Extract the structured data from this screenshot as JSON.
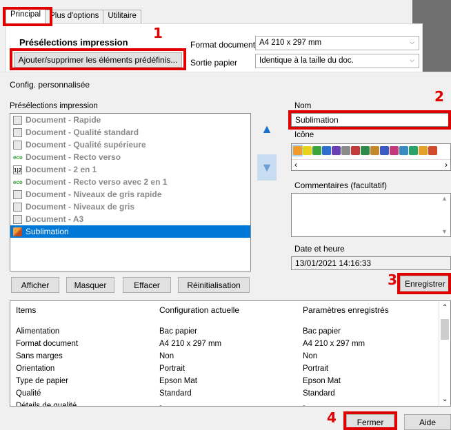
{
  "tabs": [
    {
      "label": "Principal",
      "active": true
    },
    {
      "label": "Plus d'options",
      "active": false
    },
    {
      "label": "Utilitaire",
      "active": false
    }
  ],
  "main": {
    "preset_title": "Présélections impression",
    "add_button": "Ajouter/supprimer les éléments prédéfinis...",
    "format_label": "Format document",
    "format_value": "A4 210 x 297 mm",
    "output_label": "Sortie papier",
    "output_value": "Identique à la taille du doc."
  },
  "dialog": {
    "title": "Config. personnalisée",
    "list_label": "Présélections impression",
    "presets": [
      {
        "label": "Document - Rapide",
        "icon": "document-icon"
      },
      {
        "label": "Document - Qualité standard",
        "icon": "document-icon"
      },
      {
        "label": "Document - Qualité supérieure",
        "icon": "document-icon"
      },
      {
        "label": "Document - Recto verso",
        "icon": "eco-icon"
      },
      {
        "label": "Document - 2 en 1",
        "icon": "two-in-one-icon"
      },
      {
        "label": "Document - Recto verso avec 2 en 1",
        "icon": "eco-icon"
      },
      {
        "label": "Document - Niveaux de gris rapide",
        "icon": "document-icon"
      },
      {
        "label": "Document - Niveaux de gris",
        "icon": "document-icon"
      },
      {
        "label": "Document - A3",
        "icon": "document-icon"
      },
      {
        "label": "Sublimation",
        "icon": "pencil-icon",
        "selected": true
      }
    ],
    "name_label": "Nom",
    "name_value": "Sublimation",
    "icon_label": "Icône",
    "icon_colors": [
      "#f29b2b",
      "#e8d21a",
      "#3aa53a",
      "#2c6fd1",
      "#6a3fb5",
      "#8a8a8a",
      "#c23a3a",
      "#2d8a4a",
      "#c28a2a",
      "#3a5bc2",
      "#c23a7a",
      "#3a8ac2",
      "#2aa36a",
      "#e3a02a",
      "#d14a2a"
    ],
    "comments_label": "Commentaires (facultatif)",
    "date_label": "Date et heure",
    "date_value": "13/01/2021 14:16:33",
    "buttons": {
      "show": "Afficher",
      "hide": "Masquer",
      "delete": "Effacer",
      "reset": "Réinitialisation",
      "save": "Enregistrer"
    },
    "table": {
      "headers": [
        "Items",
        "Configuration actuelle",
        "Paramètres enregistrés"
      ],
      "rows": [
        [
          "Alimentation",
          "Bac papier",
          "Bac papier"
        ],
        [
          "Format document",
          "A4 210 x 297 mm",
          "A4 210 x 297 mm"
        ],
        [
          "Sans marges",
          "Non",
          "Non"
        ],
        [
          "Orientation",
          "Portrait",
          "Portrait"
        ],
        [
          "Type de papier",
          "Epson Mat",
          "Epson Mat"
        ],
        [
          "Qualité",
          "Standard",
          "Standard"
        ],
        [
          "Détails de qualité",
          "-",
          "-"
        ]
      ]
    },
    "close_button": "Fermer",
    "help_button": "Aide"
  },
  "annotations": [
    "1",
    "2",
    "3",
    "4"
  ]
}
